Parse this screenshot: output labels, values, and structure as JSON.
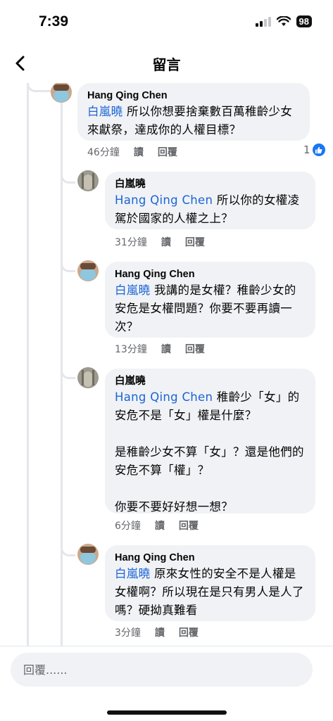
{
  "status_bar": {
    "time": "7:39",
    "battery": "98"
  },
  "header": {
    "title": "留言"
  },
  "comments": [
    {
      "author": "Hang Qing Chen",
      "mention": "白嵐曉",
      "text": "所以你想要捨棄數百萬稚齡少女來獻祭，達成你的人權目標？",
      "time": "46分鐘",
      "read": "讀",
      "reply": "回覆",
      "reaction_count": "1"
    },
    {
      "author": "白嵐曉",
      "mention": "Hang Qing Chen",
      "text": "所以你的女權凌駕於國家的人權之上？",
      "time": "31分鐘",
      "read": "讀",
      "reply": "回覆"
    },
    {
      "author": "Hang Qing Chen",
      "mention": "白嵐曉",
      "text": "我講的是女權？稚齡少女的安危是女權問題？你要不要再讀一次？",
      "time": "13分鐘",
      "read": "讀",
      "reply": "回覆"
    },
    {
      "author": "白嵐曉",
      "mention": "Hang Qing Chen",
      "paragraphs": [
        "稚齡少「女」的安危不是「女」權是什麼？",
        "是稚齡少女不算「女」？還是他們的安危不算「權」？",
        "你要不要好好想一想？"
      ],
      "time": "6分鐘",
      "read": "讀",
      "reply": "回覆"
    },
    {
      "author": "Hang Qing Chen",
      "mention": "白嵐曉",
      "text": "原來女性的安全不是人權是女權啊？所以現在是只有男人是人了嗎？硬拗真難看",
      "time": "3分鐘",
      "read": "讀",
      "reply": "回覆"
    }
  ],
  "composer": {
    "placeholder": "回覆......"
  },
  "colors": {
    "mention": "#1b64d6",
    "bubble": "#f0f2f5",
    "like": "#1877f2"
  }
}
